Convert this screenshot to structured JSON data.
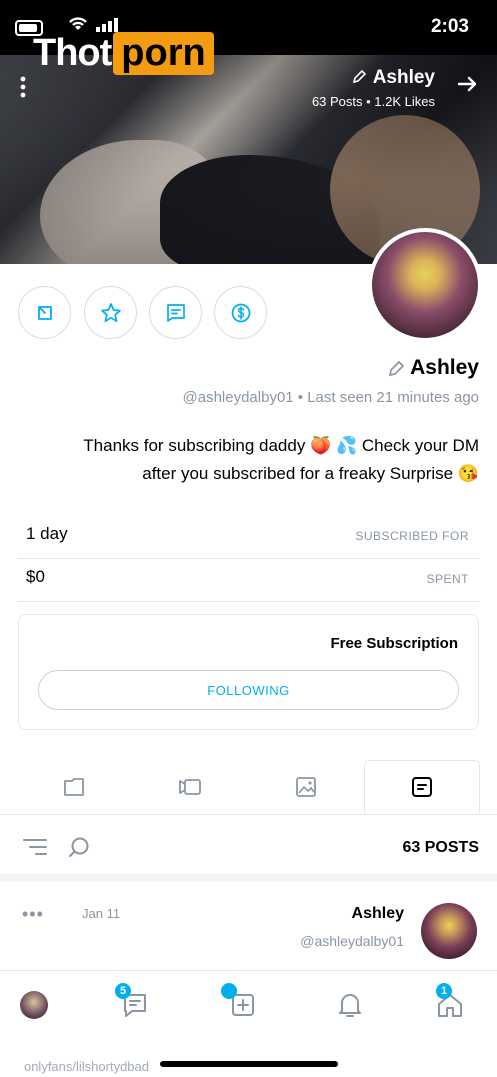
{
  "status_bar": {
    "time": "2:03"
  },
  "brand": {
    "word": "Thot",
    "highlight": "porn"
  },
  "cover": {
    "title": "Ashley",
    "subtitle": "63 Posts • 1.2K Likes"
  },
  "profile": {
    "name": "Ashley",
    "handle_line": "@ashleydalby01 • Last seen 21 minutes ago",
    "bio_line1": "Thanks for subscribing daddy 🍑 💦 Check your DM",
    "bio_line2": "after you subscribed for a freaky Surprise 😘"
  },
  "info": {
    "subscribed_label": "SUBSCRIBED FOR",
    "subscribed_value": "1 day",
    "spent_label": "SPENT",
    "spent_value": "$0"
  },
  "subscription": {
    "title": "Free Subscription",
    "button": "FOLLOWING"
  },
  "posts": {
    "count_label": "63 POSTS"
  },
  "post": {
    "author": "Ashley",
    "handle": "@ashleydalby01",
    "date": "Jan 11",
    "more": "•••"
  },
  "nav": {
    "messages_badge": "5",
    "home_badge": "1"
  },
  "watermark": "onlyfans/lilshortydbad",
  "colors": {
    "accent": "#00aff0",
    "brand_orange": "#f39c12",
    "muted": "#8a96a3"
  }
}
